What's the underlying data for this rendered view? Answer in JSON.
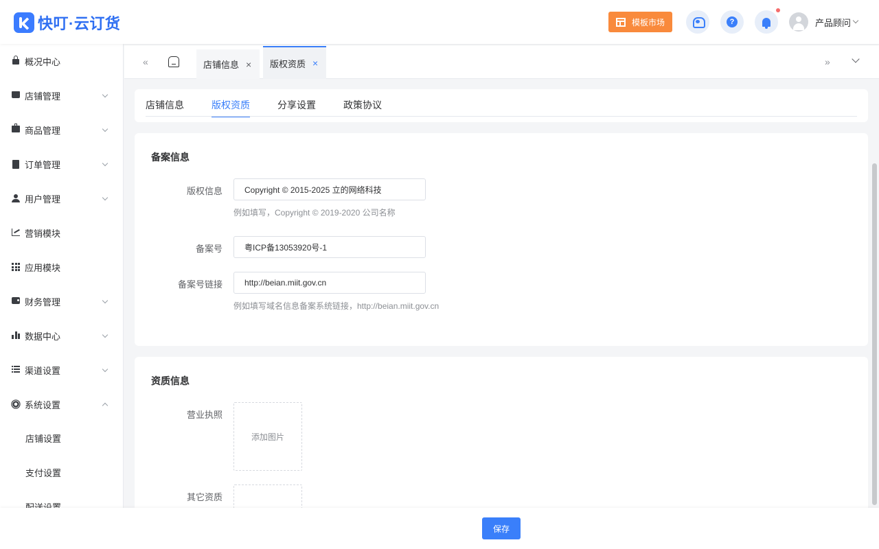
{
  "app": {
    "logo_text": "快叮·云订货",
    "brand_color": "#2f6ff2",
    "accent_color": "#3a7ffa",
    "market_color": "#f98a3c"
  },
  "header": {
    "template_market_label": "模板市场",
    "template_market_icon": "layout-icon",
    "service_icon": "customer-service-icon",
    "help_icon": "help-icon",
    "help_glyph": "?",
    "bell_icon": "bell-icon",
    "user_name": "产品顾问"
  },
  "sidebar": {
    "items": [
      {
        "label": "概况中心",
        "icon": "lock-icon"
      },
      {
        "label": "店铺管理",
        "icon": "shop-icon"
      },
      {
        "label": "商品管理",
        "icon": "box-icon"
      },
      {
        "label": "订单管理",
        "icon": "clipboard-icon"
      },
      {
        "label": "用户管理",
        "icon": "user-icon"
      },
      {
        "label": "营销模块",
        "icon": "trend-icon"
      },
      {
        "label": "应用模块",
        "icon": "grid-icon"
      },
      {
        "label": "财务管理",
        "icon": "wallet-icon"
      },
      {
        "label": "数据中心",
        "icon": "bar-chart-icon"
      },
      {
        "label": "渠道设置",
        "icon": "list-icon"
      },
      {
        "label": "系统设置",
        "icon": "gear-icon"
      }
    ],
    "sub_items": [
      "店铺设置",
      "支付设置",
      "配送设置"
    ]
  },
  "tabbar": {
    "tabs": [
      {
        "label": "店铺信息",
        "close": "×"
      },
      {
        "label": "版权资质",
        "close": "×"
      }
    ],
    "prev_glyph": "«",
    "next_glyph": "»"
  },
  "subtabs": [
    "店铺信息",
    "版权资质",
    "分享设置",
    "政策协议"
  ],
  "record": {
    "title": "备案信息",
    "copyright_label": "版权信息",
    "copyright_value": "Copyright © 2015-2025 立的网络科技",
    "copyright_hint": "例如填写，Copyright © 2019-2020 公司名称",
    "icp_label": "备案号",
    "icp_value": "粤ICP备13053920号-1",
    "icp_link_label": "备案号链接",
    "icp_link_value": "http://beian.miit.gov.cn",
    "icp_link_hint": "例如填写域名信息备案系统链接，http://beian.miit.gov.cn"
  },
  "qualification": {
    "title": "资质信息",
    "license_label": "营业执照",
    "add_image_label": "添加图片",
    "other_label": "其它资质"
  },
  "footer": {
    "save_label": "保存"
  }
}
